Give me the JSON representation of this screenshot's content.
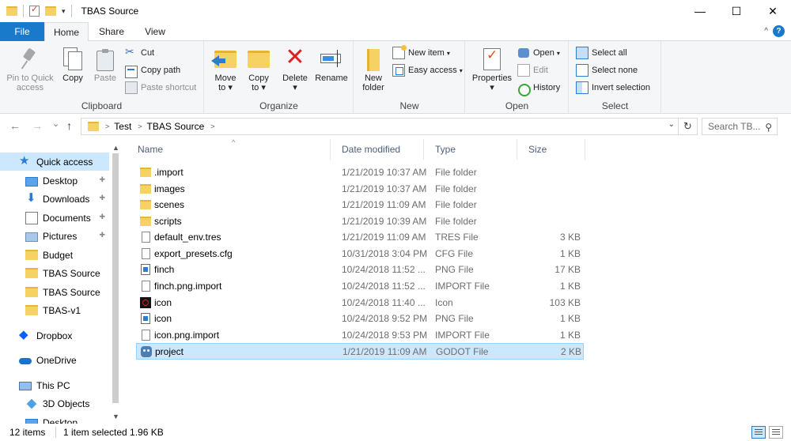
{
  "window": {
    "title": "TBAS Source",
    "minimize": "—",
    "maximize": "☐",
    "close": "✕"
  },
  "ribbon_tabs": {
    "file": "File",
    "home": "Home",
    "share": "Share",
    "view": "View",
    "help": "?",
    "collapse": "^"
  },
  "ribbon": {
    "clipboard": {
      "label": "Clipboard",
      "pin_line1": "Pin to Quick",
      "pin_line2": "access",
      "copy": "Copy",
      "paste": "Paste",
      "cut": "Cut",
      "copy_path": "Copy path",
      "paste_shortcut": "Paste shortcut"
    },
    "organize": {
      "label": "Organize",
      "move_to_1": "Move",
      "move_to_2": "to ▾",
      "copy_to_1": "Copy",
      "copy_to_2": "to ▾",
      "delete_1": "Delete",
      "delete_2": "▾",
      "rename": "Rename"
    },
    "new": {
      "label": "New",
      "new_folder_1": "New",
      "new_folder_2": "folder",
      "new_item": "New item",
      "easy_access": "Easy access"
    },
    "open": {
      "label": "Open",
      "properties_1": "Properties",
      "properties_2": "▾",
      "open": "Open",
      "edit": "Edit",
      "history": "History"
    },
    "select": {
      "label": "Select",
      "select_all": "Select all",
      "select_none": "Select none",
      "invert_selection": "Invert selection"
    }
  },
  "address": {
    "back": "←",
    "forward": "→",
    "recent": "⌄",
    "up": "↑",
    "crumbs": [
      "Test",
      "TBAS Source"
    ],
    "dropdown": "⌄",
    "refresh": "↻",
    "search_placeholder": "Search TB...",
    "search_icon": "⚲"
  },
  "nav": {
    "items": [
      {
        "label": "Quick access",
        "icon": "star-icon"
      },
      {
        "label": "Desktop",
        "icon": "desktop-icon",
        "pinned": true
      },
      {
        "label": "Downloads",
        "icon": "download-icon",
        "pinned": true
      },
      {
        "label": "Documents",
        "icon": "documents-icon",
        "pinned": true
      },
      {
        "label": "Pictures",
        "icon": "pictures-icon",
        "pinned": true
      },
      {
        "label": "Budget",
        "icon": "folder-icon"
      },
      {
        "label": "TBAS Source",
        "icon": "folder-icon"
      },
      {
        "label": "TBAS Source",
        "icon": "folder-icon"
      },
      {
        "label": "TBAS-v1",
        "icon": "folder-icon"
      },
      {
        "label": "Dropbox",
        "icon": "dropbox-icon"
      },
      {
        "label": "OneDrive",
        "icon": "onedrive-icon"
      },
      {
        "label": "This PC",
        "icon": "pc-icon"
      },
      {
        "label": "3D Objects",
        "icon": "3d-objects-icon"
      },
      {
        "label": "Desktop",
        "icon": "desktop-icon"
      }
    ],
    "pin_glyph": "📌"
  },
  "columns": {
    "name": "Name",
    "date": "Date modified",
    "type": "Type",
    "size": "Size",
    "sort_glyph": "^"
  },
  "files": [
    {
      "name": ".import",
      "date": "1/21/2019 10:37 AM",
      "type": "File folder",
      "size": "",
      "icon": "folder-icon"
    },
    {
      "name": "images",
      "date": "1/21/2019 10:37 AM",
      "type": "File folder",
      "size": "",
      "icon": "folder-icon"
    },
    {
      "name": "scenes",
      "date": "1/21/2019 11:09 AM",
      "type": "File folder",
      "size": "",
      "icon": "folder-icon"
    },
    {
      "name": "scripts",
      "date": "1/21/2019 10:39 AM",
      "type": "File folder",
      "size": "",
      "icon": "folder-icon"
    },
    {
      "name": "default_env.tres",
      "date": "1/21/2019 11:09 AM",
      "type": "TRES File",
      "size": "3 KB",
      "icon": "file-icon"
    },
    {
      "name": "export_presets.cfg",
      "date": "10/31/2018 3:04 PM",
      "type": "CFG File",
      "size": "1 KB",
      "icon": "file-icon"
    },
    {
      "name": "finch",
      "date": "10/24/2018 11:52 ...",
      "type": "PNG File",
      "size": "17 KB",
      "icon": "image-icon"
    },
    {
      "name": "finch.png.import",
      "date": "10/24/2018 11:52 ...",
      "type": "IMPORT File",
      "size": "1 KB",
      "icon": "file-icon"
    },
    {
      "name": "icon",
      "date": "10/24/2018 11:40 ...",
      "type": "Icon",
      "size": "103 KB",
      "icon": "ico-icon"
    },
    {
      "name": "icon",
      "date": "10/24/2018 9:52 PM",
      "type": "PNG File",
      "size": "1 KB",
      "icon": "image-icon"
    },
    {
      "name": "icon.png.import",
      "date": "10/24/2018 9:53 PM",
      "type": "IMPORT File",
      "size": "1 KB",
      "icon": "file-icon"
    },
    {
      "name": "project",
      "date": "1/21/2019 11:09 AM",
      "type": "GODOT File",
      "size": "2 KB",
      "icon": "godot-icon",
      "selected": true
    }
  ],
  "status": {
    "count": "12 items",
    "selection": "1 item selected  1.96 KB"
  }
}
